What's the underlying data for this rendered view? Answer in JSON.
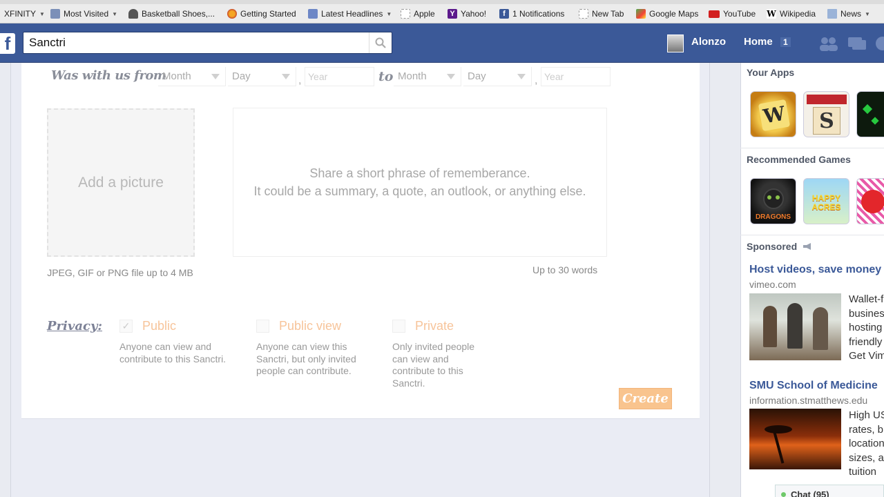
{
  "bookmarks": [
    {
      "label": "XFINITY",
      "icon": "xfinity-icon",
      "dropdown": true
    },
    {
      "label": "Most Visited",
      "icon": "most-visited-icon",
      "dropdown": true
    },
    {
      "label": "Basketball Shoes,...",
      "icon": "shoe-icon",
      "dropdown": false
    },
    {
      "label": "Getting Started",
      "icon": "firefox-icon",
      "dropdown": false
    },
    {
      "label": "Latest Headlines",
      "icon": "rss-icon",
      "dropdown": true
    },
    {
      "label": "Apple",
      "icon": "page-icon",
      "dropdown": false
    },
    {
      "label": "Yahoo!",
      "icon": "yahoo-icon",
      "dropdown": false
    },
    {
      "label": "1 Notifications",
      "icon": "facebook-icon",
      "dropdown": false
    },
    {
      "label": "New Tab",
      "icon": "page-icon",
      "dropdown": false
    },
    {
      "label": "Google Maps",
      "icon": "maps-icon",
      "dropdown": false
    },
    {
      "label": "YouTube",
      "icon": "youtube-icon",
      "dropdown": false
    },
    {
      "label": "Wikipedia",
      "icon": "wikipedia-icon",
      "dropdown": false
    },
    {
      "label": "News",
      "icon": "folder-icon",
      "dropdown": true
    }
  ],
  "header": {
    "logo": "f",
    "search_value": "Sanctri",
    "user_name": "Alonzo",
    "home_label": "Home",
    "home_count": "1",
    "brand_color": "#3b5998"
  },
  "form": {
    "was_with_us_label": "Was with us from",
    "from": {
      "month": "Month",
      "day": "Day",
      "year": "Year"
    },
    "comma": ",",
    "to_label": "to",
    "to": {
      "month": "Month",
      "day": "Day",
      "year": "Year"
    },
    "picture_label": "Add a picture",
    "picture_hint": "JPEG, GIF or PNG file up to 4 MB",
    "phrase_placeholder": "Share a short phrase of rememberance.\nIt could be a summary, a quote, an outlook, or anything else.",
    "word_limit": "Up to 30 words",
    "privacy_label": "Privacy:",
    "privacy_options": [
      {
        "title": "Public",
        "checked": true,
        "description": "Anyone can view and contribute to this Sanctri."
      },
      {
        "title": "Public view",
        "checked": false,
        "description": "Anyone can view this Sanctri, but only invited people can contribute."
      },
      {
        "title": "Private",
        "checked": false,
        "description": "Only invited people can view and contribute to this Sanctri."
      }
    ],
    "create_label": "Create",
    "accent_color": "#f9c48e"
  },
  "sidebar": {
    "your_apps_title": "Your Apps",
    "apps": [
      {
        "name": "words-with-friends-icon"
      },
      {
        "name": "scrabble-icon"
      },
      {
        "name": "green-app-icon"
      }
    ],
    "recommended_title": "Recommended Games",
    "games": [
      {
        "name": "dragons-icon",
        "label": "DRAGONS"
      },
      {
        "name": "happy-acres-icon",
        "label": "HAPPY ACRES"
      },
      {
        "name": "candy-icon"
      }
    ],
    "sponsored_title": "Sponsored",
    "ads": [
      {
        "title": "Host videos, save money",
        "url": "vimeo.com",
        "text": [
          "Wallet-f",
          "busines",
          "hosting",
          "friendly",
          "Get Vim"
        ]
      },
      {
        "title": "SMU School of Medicine",
        "url": "information.stmatthews.edu",
        "text": [
          "High US",
          "rates, b",
          "location",
          "sizes, a",
          "tuition"
        ]
      }
    ],
    "chat_label": "Chat (95)"
  }
}
